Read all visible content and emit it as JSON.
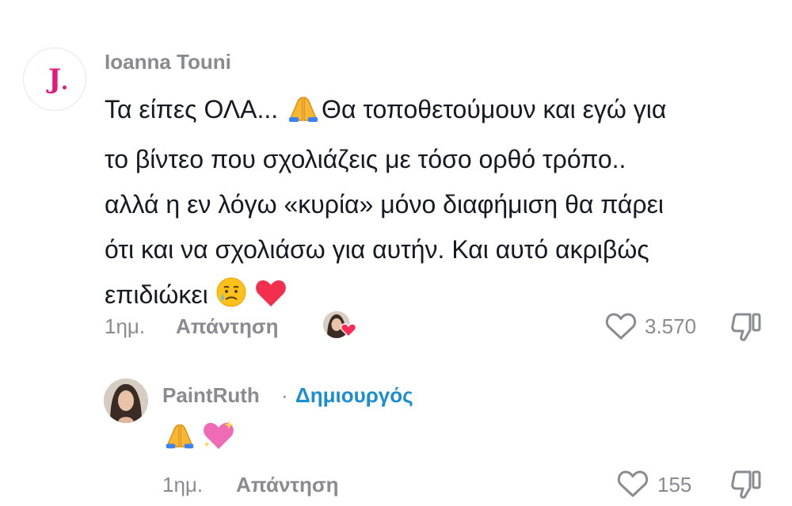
{
  "comment": {
    "avatar_text": "J",
    "author": "Ioanna Touni",
    "lines": [
      "Τα είπες ΟΛΑ... ",
      "Θα τοποθετούμουν και εγώ για",
      "το βίντεο που σχολιάζεις με τόσο ορθό τρόπο..",
      "αλλά η εν λόγω «κυρία» μόνο διαφήμιση θα πάρει",
      "ότι και να σχολιάσω για αυτήν. Και αυτό ακριβώς",
      "επιδιώκει "
    ],
    "emojis": [
      "folded-hands",
      "crying-face",
      "red-heart"
    ],
    "time": "1ημ.",
    "reply_label": "Απάντηση",
    "creator_liked": true,
    "like_count": "3.570"
  },
  "reply": {
    "author": "PaintRuth",
    "separator": "·",
    "badge": "Δημιουργός",
    "emojis": [
      "folded-hands",
      "sparkling-heart"
    ],
    "time": "1ημ.",
    "reply_label": "Απάντηση",
    "like_count": "155"
  },
  "colors": {
    "text": "#161823",
    "muted": "#8a8b91",
    "creator": "#1a8ed1",
    "logo": "#e3197c",
    "heart": "#f2304d"
  }
}
